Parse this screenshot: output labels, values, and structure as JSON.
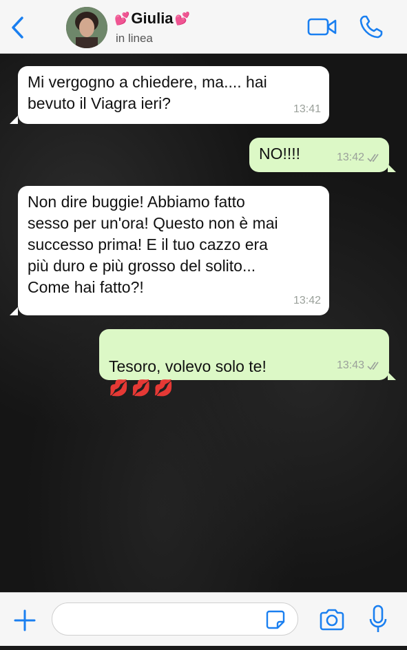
{
  "header": {
    "contact_name": "Giulia",
    "status": "in linea"
  },
  "messages": [
    {
      "direction": "in",
      "text": "Mi vergogno a chiedere, ma.... hai\nbevuto il Viagra ieri?",
      "time": "13:41"
    },
    {
      "direction": "out",
      "text": "NO!!!!",
      "time": "13:42",
      "ticks": "read"
    },
    {
      "direction": "in",
      "text": "Non dire buggie! Abbiamo fatto\nsesso per un'ora! Questo non è mai\nsuccesso prima! E il tuo cazzo era\npiù duro e più grosso del solito...\nCome hai fatto?!",
      "time": "13:42"
    },
    {
      "direction": "out",
      "text": "Tesoro, volevo solo te!",
      "emoji": "💋💋💋",
      "time": "13:43",
      "ticks": "read"
    }
  ],
  "composer": {
    "value": "",
    "placeholder": ""
  },
  "colors": {
    "accent": "#1a7ff0",
    "incoming_bubble": "#ffffff",
    "outgoing_bubble": "#dcf8c6",
    "chat_background": "#151515"
  },
  "icons": {
    "back": "chevron-left-icon",
    "video": "video-camera-icon",
    "call": "phone-icon",
    "plus": "plus-icon",
    "sticker": "sticker-icon",
    "camera": "camera-icon",
    "mic": "microphone-icon",
    "read": "double-check-icon"
  }
}
